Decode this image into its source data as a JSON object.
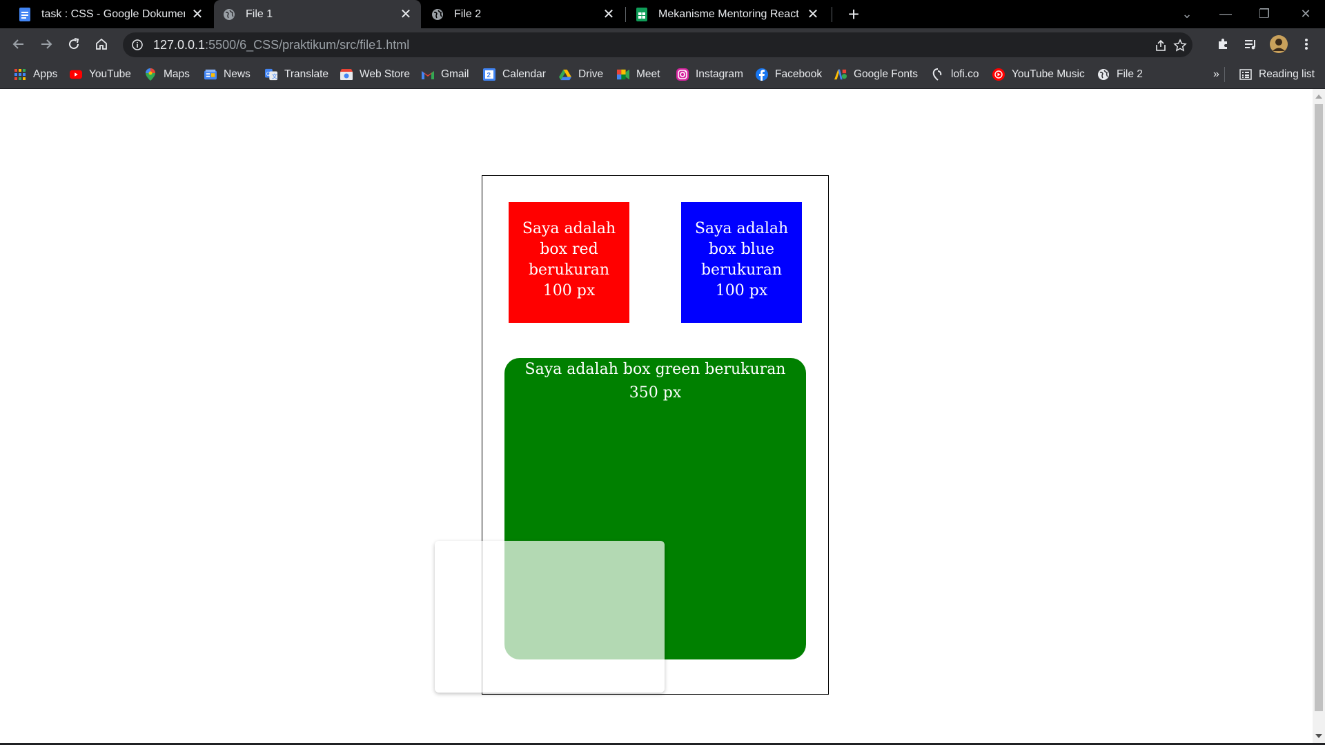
{
  "tabs": [
    {
      "title": "task : CSS - Google Dokumen",
      "icon": "google-docs-icon",
      "active": false
    },
    {
      "title": "File 1",
      "icon": "globe-icon",
      "active": true
    },
    {
      "title": "File 2",
      "icon": "globe-icon",
      "active": false
    },
    {
      "title": "Mekanisme Mentoring React - Go",
      "icon": "google-sheets-icon",
      "active": false
    }
  ],
  "toolbar": {
    "url_host": "127.0.0.1",
    "url_path": ":5500/6_CSS/praktikum/src/file1.html"
  },
  "bookmarks": {
    "items": [
      {
        "label": "Apps",
        "icon": "apps-grid-icon"
      },
      {
        "label": "YouTube",
        "icon": "youtube-icon"
      },
      {
        "label": "Maps",
        "icon": "maps-icon"
      },
      {
        "label": "News",
        "icon": "news-icon"
      },
      {
        "label": "Translate",
        "icon": "translate-icon"
      },
      {
        "label": "Web Store",
        "icon": "web-store-icon"
      },
      {
        "label": "Gmail",
        "icon": "gmail-icon"
      },
      {
        "label": "Calendar",
        "icon": "calendar-icon"
      },
      {
        "label": "Drive",
        "icon": "drive-icon"
      },
      {
        "label": "Meet",
        "icon": "meet-icon"
      },
      {
        "label": "Instagram",
        "icon": "instagram-icon"
      },
      {
        "label": "Facebook",
        "icon": "facebook-icon"
      },
      {
        "label": "Google Fonts",
        "icon": "google-fonts-icon"
      },
      {
        "label": "lofi.co",
        "icon": "lofi-icon"
      },
      {
        "label": "YouTube Music",
        "icon": "youtube-music-icon"
      },
      {
        "label": "File 2",
        "icon": "globe-icon"
      }
    ],
    "overflow": "»",
    "reading_list": "Reading list"
  },
  "page": {
    "red_box": "Saya adalah box red berukuran 100 px",
    "blue_box": "Saya adalah box blue berukuran 100 px",
    "green_box": "Saya adalah box green berukuran 350 px"
  },
  "colors": {
    "red": "#ff0000",
    "blue": "#0000ff",
    "green": "#008000"
  }
}
